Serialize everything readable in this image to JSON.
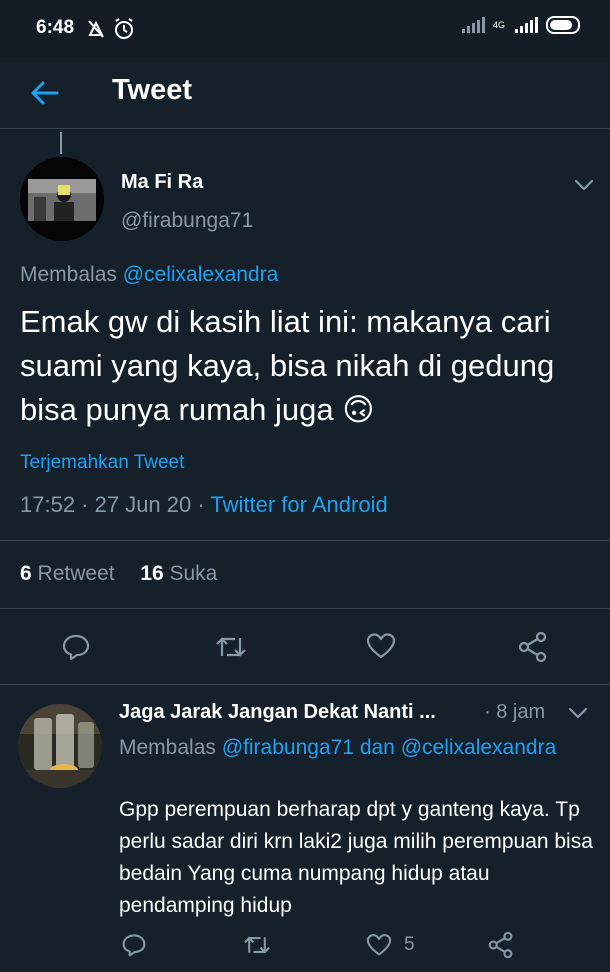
{
  "status_bar": {
    "time": "6:48",
    "network": "4G"
  },
  "header": {
    "title": "Tweet"
  },
  "tweet": {
    "author_name": "Ma Fi Ra",
    "author_handle": "@firabunga71",
    "replying_prefix": "Membalas",
    "replying_to": "@celixalexandra",
    "text": "Emak gw di kasih liat ini: makanya cari suami yang kaya, bisa nikah di gedung bisa punya rumah juga 🙃",
    "translate_label": "Terjemahkan Tweet",
    "timestamp": "17:52 · 27 Jun 20 · ",
    "source": "Twitter for Android",
    "retweet_count": "6",
    "retweet_label": "Retweet",
    "like_count": "16",
    "like_label": "Suka"
  },
  "reply": {
    "author_name": "Jaga Jarak Jangan Dekat Nanti ...",
    "time": "· 8 jam",
    "replying_prefix": "Membalas",
    "replying_to_1": "@firabunga71",
    "replying_and": "dan",
    "replying_to_2": "@celixalexandra",
    "text": "Gpp perempuan berharap dpt y ganteng kaya. Tp perlu sadar diri krn laki2 juga milih perempuan bisa bedain   Yang cuma numpang hidup atau pendamping hidup",
    "like_count": "5"
  },
  "colors": {
    "background": "#15202b",
    "accent": "#1da1f2",
    "secondary_text": "#8899a6",
    "divider": "#38444d"
  }
}
